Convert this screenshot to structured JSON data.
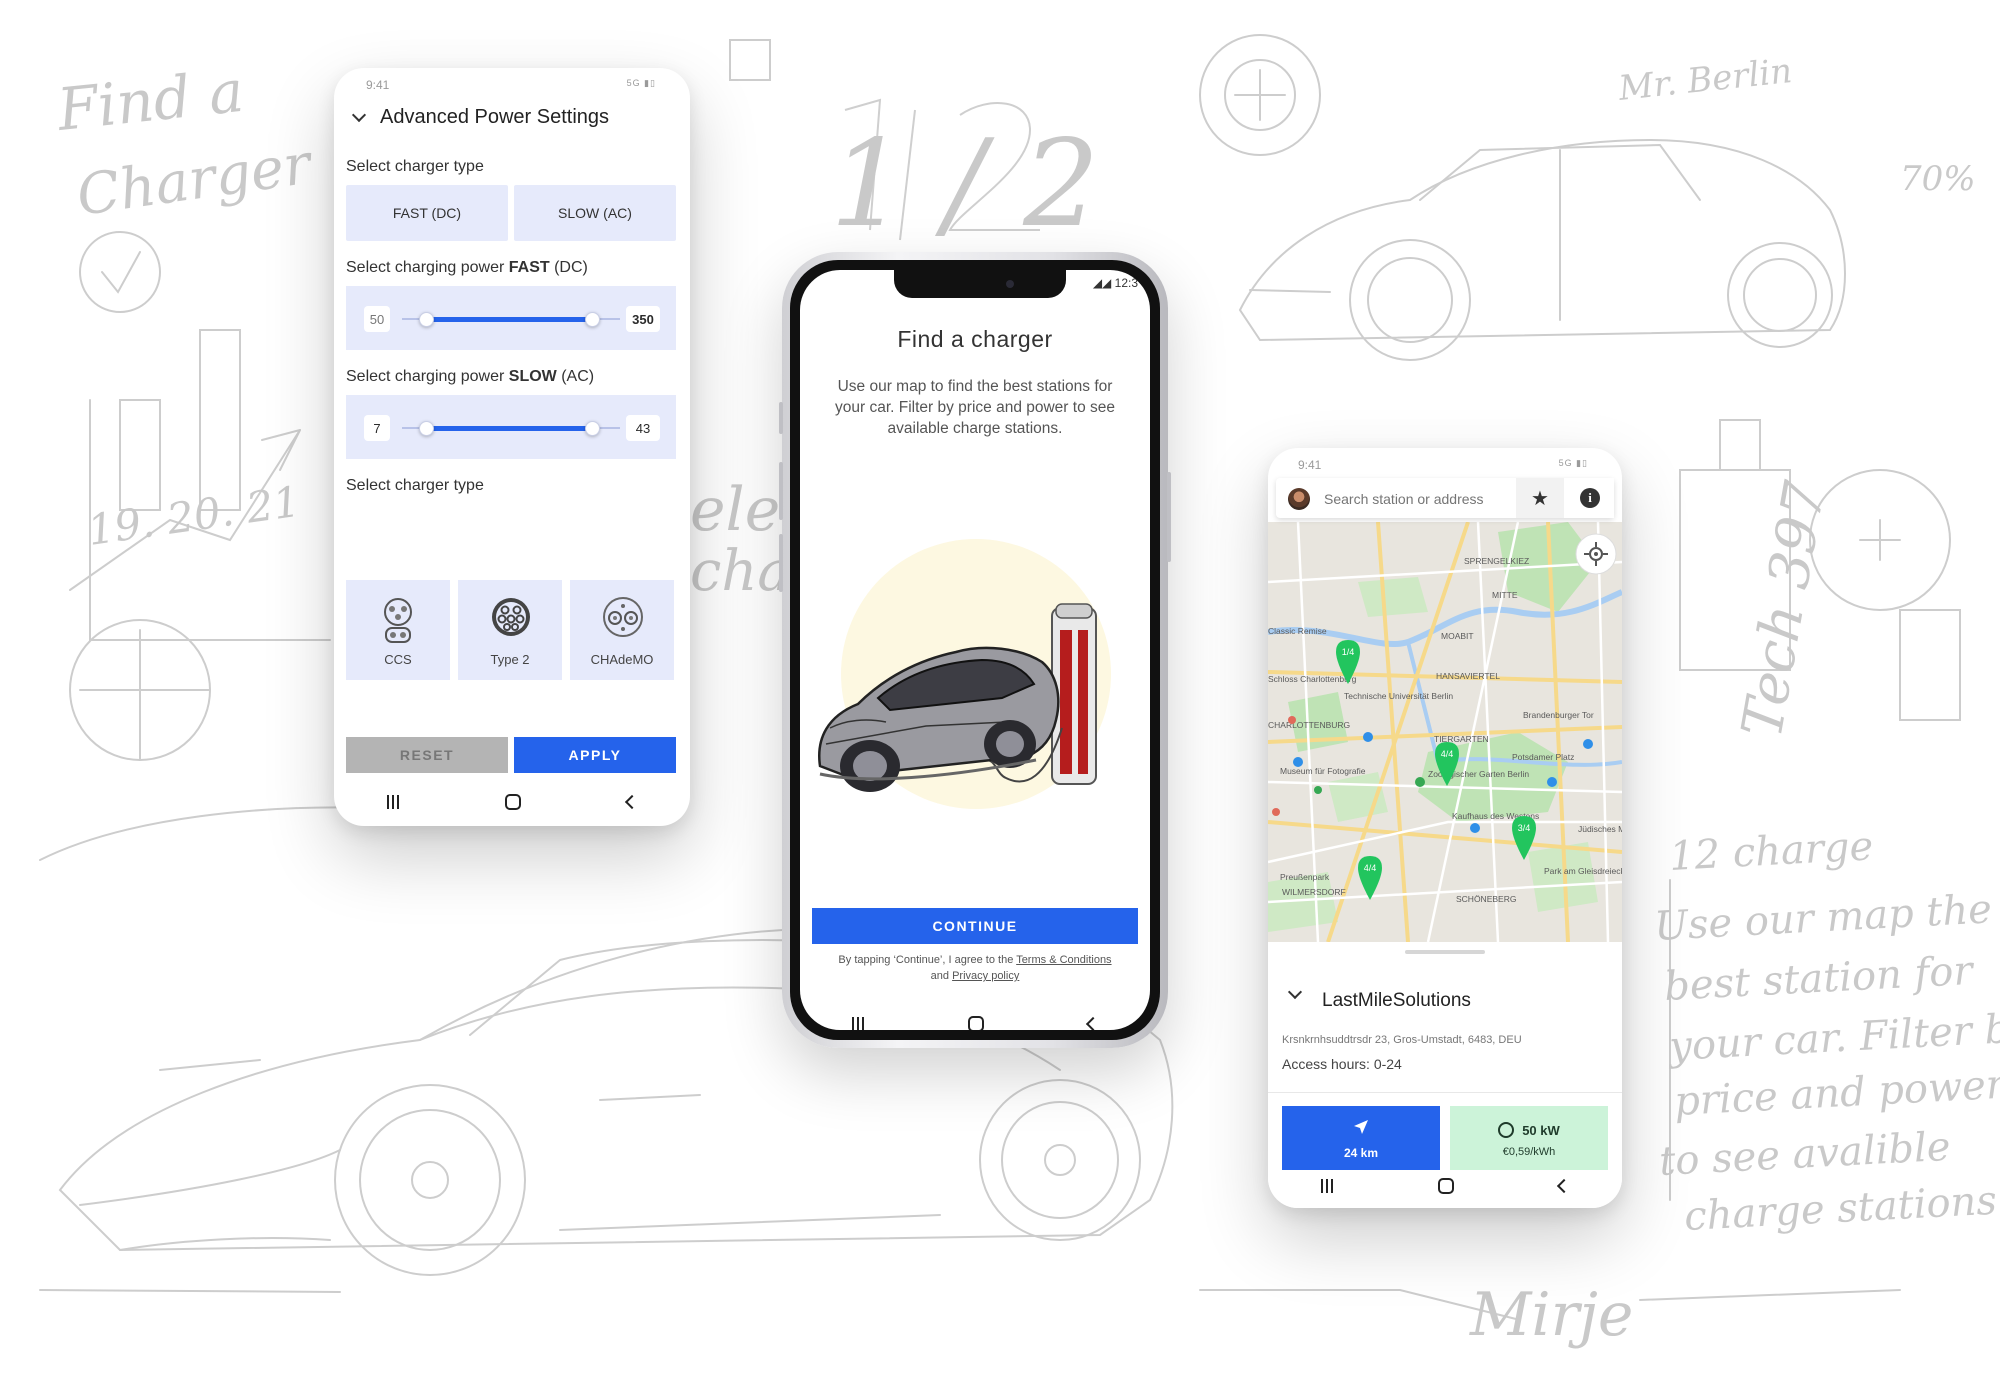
{
  "background_sketch": {
    "notes": [
      "Find a",
      "Charger",
      "1 / 2",
      "12 charge",
      "Use our map the",
      "best station for",
      "your car. Filter by",
      "price and power",
      "to see avalible",
      "charge stations",
      "Tech 397",
      "Mr. Berlin",
      "70%",
      "19. 20. 21",
      "Mirje"
    ]
  },
  "settings": {
    "status_time": "9:41",
    "status_signal": "5G",
    "title": "Advanced Power Settings",
    "charger_type_label": "Select charger type",
    "fast_label": "FAST (DC)",
    "slow_label": "SLOW (AC)",
    "fast_power_prefix": "Select charging power ",
    "fast_power_bold": "FAST",
    "fast_power_suffix": " (DC)",
    "fast_min": "50",
    "fast_max": "350",
    "slow_power_prefix": "Select charging power ",
    "slow_power_bold": "SLOW",
    "slow_power_suffix": " (AC)",
    "slow_min": "7",
    "slow_max": "43",
    "connector_label": "Select charger type",
    "connectors": [
      "CCS",
      "Type 2",
      "CHAdeMO"
    ],
    "reset_label": "RESET",
    "apply_label": "APPLY"
  },
  "onboarding": {
    "status_time": "12:3",
    "title": "Find a charger",
    "body": "Use our map to find the best stations for your car. Filter by price and power to see available charge stations.",
    "cta": "CONTINUE",
    "legal_prefix": "By tapping ‘Continue’, I agree to the ",
    "terms_link": "Terms & Conditions",
    "legal_and": "and ",
    "privacy_link": "Privacy policy"
  },
  "map": {
    "status_time": "9:41",
    "status_signal": "5G",
    "search_placeholder": "Search station or address",
    "districts": [
      "SPRENGELKIEZ",
      "MITTE",
      "MOABIT",
      "Classic Remise",
      "Schloss Charlottenburg",
      "HANSAVIERTEL",
      "Technische Universität Berlin",
      "CHARLOTTENBURG",
      "TIERGARTEN",
      "Brandenburger Tor",
      "Potsdamer Platz",
      "Museum für Fotografie",
      "Zoologischer Garten Berlin",
      "Kaufhaus des Westens",
      "Jüdisches Mu",
      "Preußenpark",
      "WILMERSDORF",
      "Park am Gleisdreieck",
      "SCHÖNEBERG"
    ],
    "pins": [
      "1/4",
      "4/4",
      "3/4",
      "4/4"
    ],
    "station_name": "LastMileSolutions",
    "station_address": "Krsnkrnhsuddtrsdr 23, Gros-Umstadt, 6483, DEU",
    "access_hours": "Access hours: 0-24",
    "distance": "24 km",
    "power": "50 kW",
    "price": "€0,59/kWh"
  },
  "colors": {
    "accent": "#2563eb",
    "chip_bg": "#e6eafb",
    "pin_green": "#22c55e",
    "power_bg": "#ccf3d9",
    "reset_bg": "#b4b4b4"
  }
}
